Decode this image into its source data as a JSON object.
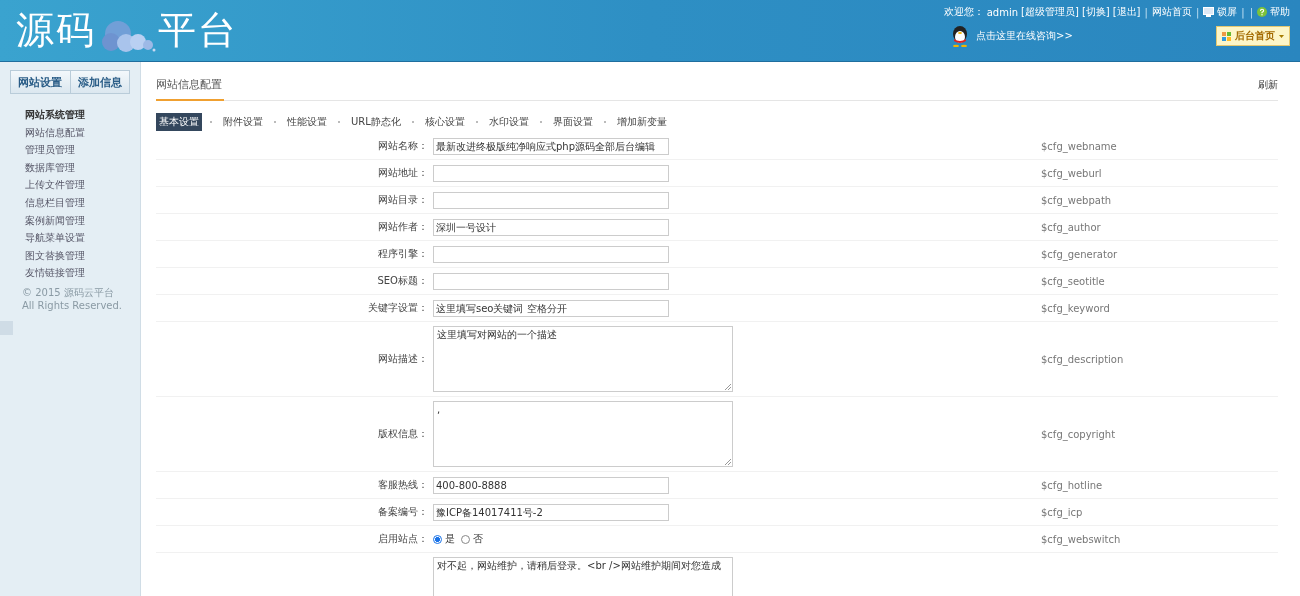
{
  "header": {
    "logo_left": "源码",
    "logo_right": "平台",
    "user_bar": [
      {
        "kind": "text",
        "text": "欢迎您："
      },
      {
        "kind": "text",
        "text": "admin"
      },
      {
        "kind": "link",
        "text": "[超级管理员]"
      },
      {
        "kind": "link",
        "text": "[切换]"
      },
      {
        "kind": "link",
        "text": "[退出]"
      },
      {
        "kind": "sep",
        "text": "|"
      },
      {
        "kind": "link",
        "text": "网站首页"
      },
      {
        "kind": "sep",
        "text": "|"
      },
      {
        "kind": "lock",
        "text": "锁屏"
      },
      {
        "kind": "sep",
        "text": "|"
      },
      {
        "kind": "sep",
        "text": "|"
      },
      {
        "kind": "help",
        "text": "帮助"
      }
    ],
    "consult_link": "点击这里在线咨询>>",
    "home_dropdown": "后台首页"
  },
  "sidebar": {
    "tabs": [
      {
        "label": "网站设置"
      },
      {
        "label": "添加信息"
      }
    ],
    "items": [
      {
        "kind": "header",
        "label": "网站系统管理"
      },
      {
        "kind": "item",
        "label": "网站信息配置"
      },
      {
        "kind": "item",
        "label": "管理员管理"
      },
      {
        "kind": "item",
        "label": "数据库管理"
      },
      {
        "kind": "item",
        "label": "上传文件管理"
      },
      {
        "kind": "item",
        "label": "信息栏目管理"
      },
      {
        "kind": "item",
        "label": "案例新闻管理"
      },
      {
        "kind": "item",
        "label": "导航菜单设置"
      },
      {
        "kind": "item",
        "label": "图文替换管理"
      },
      {
        "kind": "item",
        "label": "友情链接管理"
      }
    ],
    "copyright": [
      "© 2015 源码云平台",
      "All Rights Reserved."
    ]
  },
  "main": {
    "title": "网站信息配置",
    "refresh": "刷新",
    "tabs": [
      {
        "label": "基本设置",
        "selected": true
      },
      {
        "label": "附件设置",
        "selected": false
      },
      {
        "label": "性能设置",
        "selected": false
      },
      {
        "label": "URL静态化",
        "selected": false
      },
      {
        "label": "核心设置",
        "selected": false
      },
      {
        "label": "水印设置",
        "selected": false
      },
      {
        "label": "界面设置",
        "selected": false
      },
      {
        "label": "增加新变量",
        "selected": false
      }
    ],
    "rows": [
      {
        "kind": "text",
        "label": "网站名称：",
        "value": "最新改进终极版纯净响应式php源码全部后台编辑",
        "var": "$cfg_webname"
      },
      {
        "kind": "text",
        "label": "网站地址：",
        "value": "",
        "var": "$cfg_weburl"
      },
      {
        "kind": "text",
        "label": "网站目录：",
        "value": "",
        "var": "$cfg_webpath"
      },
      {
        "kind": "text",
        "label": "网站作者：",
        "value": "深圳一号设计",
        "var": "$cfg_author"
      },
      {
        "kind": "text",
        "label": "程序引擎：",
        "value": "",
        "var": "$cfg_generator"
      },
      {
        "kind": "text",
        "label": "SEO标题：",
        "value": "",
        "var": "$cfg_seotitle"
      },
      {
        "kind": "text",
        "label": "关键字设置：",
        "value": "这里填写seo关键词 空格分开",
        "var": "$cfg_keyword"
      },
      {
        "kind": "textarea",
        "label": "网站描述：",
        "value": "这里填写对网站的一个描述",
        "var": "$cfg_description"
      },
      {
        "kind": "textarea",
        "label": "版权信息：",
        "value": ",",
        "var": "$cfg_copyright"
      },
      {
        "kind": "text",
        "label": "客服热线：",
        "value": "400-800-8888",
        "var": "$cfg_hotline"
      },
      {
        "kind": "text",
        "label": "备案编号：",
        "value": "豫ICP备14017411号-2",
        "var": "$cfg_icp"
      },
      {
        "kind": "radio",
        "label": "启用站点：",
        "options": [
          {
            "label": "是",
            "selected": true
          },
          {
            "label": "否",
            "selected": false
          }
        ],
        "var": "$cfg_webswitch"
      },
      {
        "kind": "textarea",
        "value": "对不起，网站维护，请稍后登录。<br />网站维护期间对您造成"
      }
    ]
  }
}
